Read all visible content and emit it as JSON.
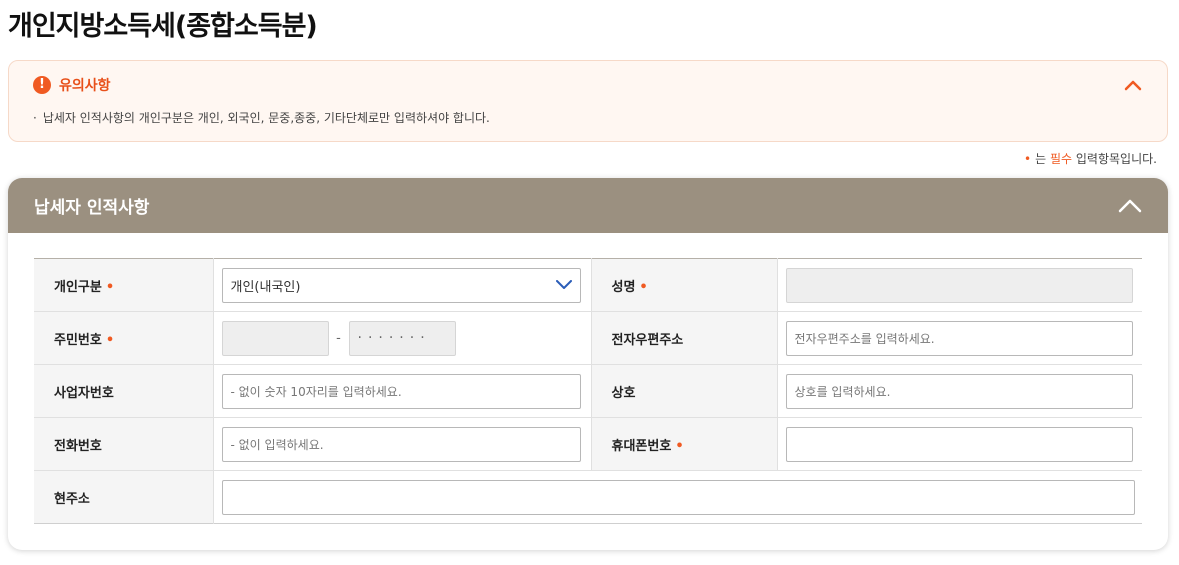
{
  "page": {
    "title": "개인지방소득세(종합소득분)"
  },
  "notice": {
    "icon_glyph": "!",
    "title": "유의사항",
    "bullet": "·",
    "body": "납세자 인적사항의 개인구분은 개인, 외국인, 문중,종중, 기타단체로만 입력하셔야 합니다."
  },
  "required_note": {
    "dot": "•",
    "prefix": "는 ",
    "emphasis": "필수",
    "suffix": " 입력항목입니다."
  },
  "panel": {
    "title": "납세자 인적사항"
  },
  "form": {
    "required_mark": "•",
    "person_type": {
      "label": "개인구분",
      "value": "개인(내국인)"
    },
    "name": {
      "label": "성명",
      "value": ""
    },
    "resident_number": {
      "label": "주민번호",
      "front": "",
      "separator": "-",
      "back_masked": "·······"
    },
    "email": {
      "label": "전자우편주소",
      "placeholder": "전자우편주소를 입력하세요."
    },
    "business_number": {
      "label": "사업자번호",
      "placeholder": "- 없이 숫자 10자리를 입력하세요."
    },
    "company": {
      "label": "상호",
      "placeholder": "상호를 입력하세요."
    },
    "phone": {
      "label": "전화번호",
      "placeholder": "- 없이 입력하세요."
    },
    "mobile": {
      "label": "휴대폰번호",
      "value": ""
    },
    "address": {
      "label": "현주소",
      "value": ""
    }
  },
  "colors": {
    "accent": "#f05a22",
    "panel_header": "#9b9080",
    "select_chevron": "#2b5db8"
  },
  "icons": {
    "notice": "alert-circle-icon",
    "collapse": "chevron-up-icon",
    "select": "chevron-down-icon"
  }
}
